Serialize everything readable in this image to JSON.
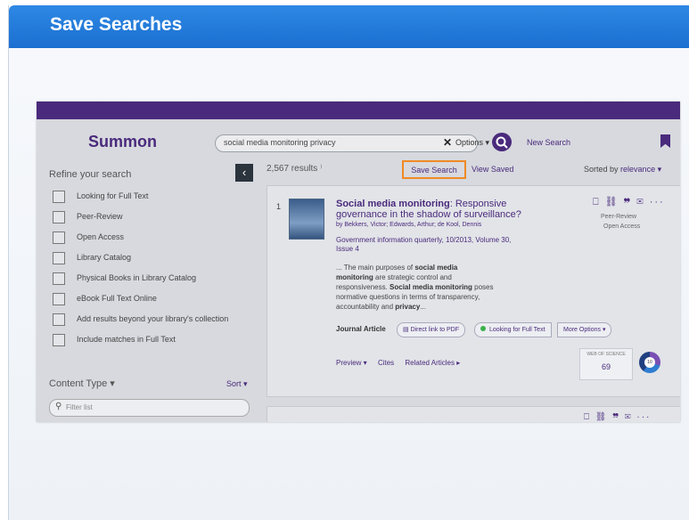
{
  "slide": {
    "title": "Save Searches"
  },
  "app": {
    "brand": "Summon",
    "search": {
      "value": "social media monitoring privacy",
      "clear": "✕",
      "options_label": "Options ▾",
      "new_search_label": "New Search"
    },
    "sidebar": {
      "refine_label": "Refine your search",
      "collapse_label": "‹",
      "filters": [
        "Looking for Full Text",
        "Peer-Review",
        "Open Access",
        "Library Catalog",
        "Physical Books in Library Catalog",
        "eBook Full Text Online",
        "Add results beyond your library's collection",
        "Include matches in Full Text"
      ],
      "content_type_label": "Content Type ▾",
      "sort_label": "Sort ▾",
      "filter_list_placeholder": "Filter list"
    },
    "results_bar": {
      "count": "2,567 results",
      "save_search": "Save Search",
      "view_saved": "View Saved",
      "sorted_by_label": "Sorted by",
      "sorted_by_value": "relevance ▾"
    },
    "result": {
      "number": "1",
      "title_bold": "Social media monitoring",
      "title_rest": ": Responsive governance in the shadow of surveillance?",
      "authors": "by Bekkers, Victor; Edwards, Arthur; de Kool, Dennis",
      "journal": "Government information quarterly, 10/2013, Volume 30, Issue 4",
      "snippet_1": "... The main purposes of ",
      "snippet_b1": "social media monitoring",
      "snippet_2": " are strategic control and responsiveness. ",
      "snippet_b2": "Social media monitoring",
      "snippet_3": " poses normative questions in terms of transparency, accountability and ",
      "snippet_b3": "privacy",
      "snippet_4": "...",
      "action_icons": "⎕ ⛓ ❞ ✉ ···",
      "peer_review": "Peer-Review",
      "open_access": "Open Access",
      "type": "Journal Article",
      "direct_link": "Direct link to PDF",
      "full_text": "Looking for Full Text",
      "more_options": "More Options ▾",
      "preview": "Preview ▾",
      "cites": "Cites",
      "related": "Related Articles ▸",
      "wos_label": "WEB OF SCIENCE",
      "wos_count": "69",
      "altmetric": "10"
    },
    "second_card_icons": "⎕ ⛓ ❞ ✉ ···"
  }
}
